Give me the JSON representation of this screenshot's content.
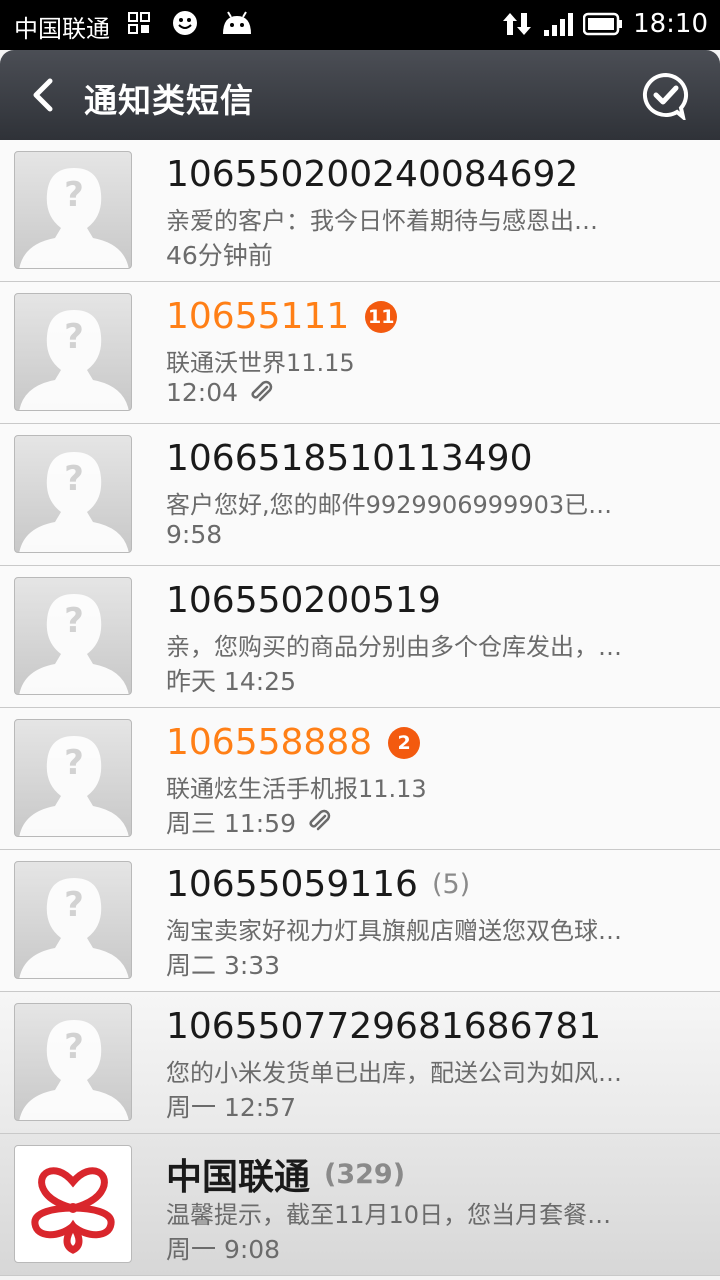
{
  "status_bar": {
    "carrier": "中国联通",
    "time": "18:10",
    "icons": [
      "grid-icon",
      "smiley-icon",
      "android-icon",
      "data-transfer-icon",
      "signal-icon",
      "battery-icon"
    ]
  },
  "header": {
    "title": "通知类短信",
    "back_icon": "back-chevron-icon",
    "action_icon": "check-bubble-icon"
  },
  "colors": {
    "unread": "#ff7f16",
    "badge": "#f35a0f",
    "titlebar": "#3a3d43"
  },
  "conversations": [
    {
      "name": "106550200240084692",
      "preview": "亲爱的客户：我今日怀着期待与感恩出…",
      "time": "46分钟前",
      "badge": "",
      "count": "",
      "unread": false,
      "attachment": false
    },
    {
      "name": "10655111",
      "preview": "联通沃世界11.15",
      "time": "12:04",
      "badge": "11",
      "count": "",
      "unread": true,
      "attachment": true
    },
    {
      "name": "1066518510113490",
      "preview": "客户您好,您的邮件9929906999903已…",
      "time": "9:58",
      "badge": "",
      "count": "",
      "unread": false,
      "attachment": false
    },
    {
      "name": "106550200519",
      "preview": "亲，您购买的商品分别由多个仓库发出，…",
      "time": "昨天 14:25",
      "badge": "",
      "count": "",
      "unread": false,
      "attachment": false
    },
    {
      "name": "106558888",
      "preview": "联通炫生活手机报11.13",
      "time": "周三 11:59",
      "badge": "2",
      "count": "",
      "unread": true,
      "attachment": true
    },
    {
      "name": "10655059116",
      "preview": "淘宝卖家好视力灯具旗舰店赠送您双色球…",
      "time": "周二 3:33",
      "badge": "",
      "count": "(5)",
      "unread": false,
      "attachment": false
    },
    {
      "name": "1065507729681686781",
      "preview": "您的小米发货单已出库，配送公司为如风…",
      "time": "周一 12:57",
      "badge": "",
      "count": "",
      "unread": false,
      "attachment": false
    },
    {
      "name": "中国联通",
      "preview": "温馨提示，截至11月10日，您当月套餐…",
      "time": "周一 9:08",
      "badge": "",
      "count": "(329)",
      "unread": false,
      "attachment": false
    }
  ]
}
